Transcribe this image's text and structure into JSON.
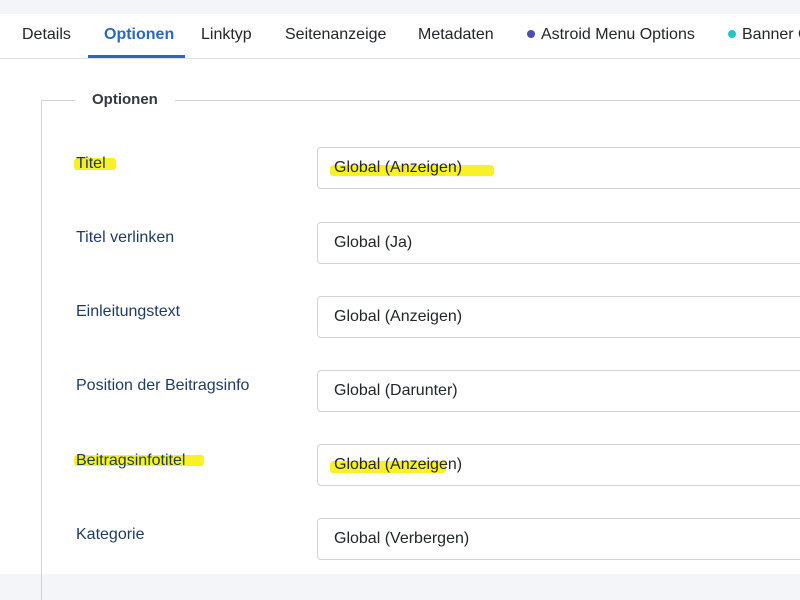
{
  "tabs": [
    {
      "label": "Details"
    },
    {
      "label": "Optionen"
    },
    {
      "label": "Linktyp"
    },
    {
      "label": "Seitenanzeige"
    },
    {
      "label": "Metadaten"
    },
    {
      "label": "Astroid Menu Options"
    },
    {
      "label": "Banner C"
    }
  ],
  "colors": {
    "accent": "#2a69b8",
    "dot_astroid": "#4a4fb3",
    "dot_banner": "#1fc8c0",
    "highlight": "#f7ef10"
  },
  "fieldset": {
    "legend": "Optionen"
  },
  "fields": [
    {
      "label": "Titel",
      "value": "Global (Anzeigen)"
    },
    {
      "label": "Titel verlinken",
      "value": "Global (Ja)"
    },
    {
      "label": "Einleitungstext",
      "value": "Global (Anzeigen)"
    },
    {
      "label": "Position der Beitragsinfo",
      "value": "Global (Darunter)"
    },
    {
      "label": "Beitragsinfotitel",
      "value": "Global (Anzeigen)"
    },
    {
      "label": "Kategorie",
      "value": "Global (Verbergen)"
    }
  ]
}
